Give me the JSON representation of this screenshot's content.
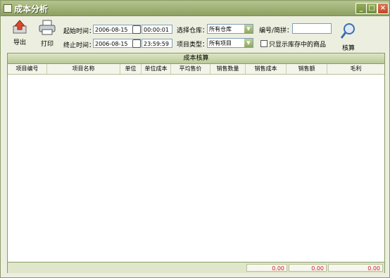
{
  "window": {
    "title": "成本分析"
  },
  "toolbar": {
    "export_label": "导出",
    "print_label": "打印",
    "calc_label": "核算"
  },
  "filters": {
    "start_label": "起始时间：",
    "start_date": "2006-08-15",
    "start_time": "00:00:01",
    "end_label": "终止时间：",
    "end_date": "2006-08-15",
    "end_time": "23:59:59",
    "warehouse_label": "选择仓库：",
    "warehouse_value": "所有仓库",
    "category_label": "项目类型：",
    "category_value": "所有项目",
    "code_label": "编号/简拼：",
    "code_value": "",
    "stock_only_label": "只显示库存中的商品"
  },
  "panel": {
    "title": "成本核算"
  },
  "table": {
    "columns": [
      "项目编号",
      "项目名称",
      "单位",
      "单位成本",
      "平均售价",
      "销售数量",
      "销售成本",
      "销售额",
      "毛利"
    ],
    "rows": []
  },
  "totals": {
    "sales_cost": "0.00",
    "sales_amount": "0.00",
    "gross_profit": "0.00"
  },
  "colors": {
    "title_bar": "#8da063",
    "total_text": "#d02020"
  }
}
